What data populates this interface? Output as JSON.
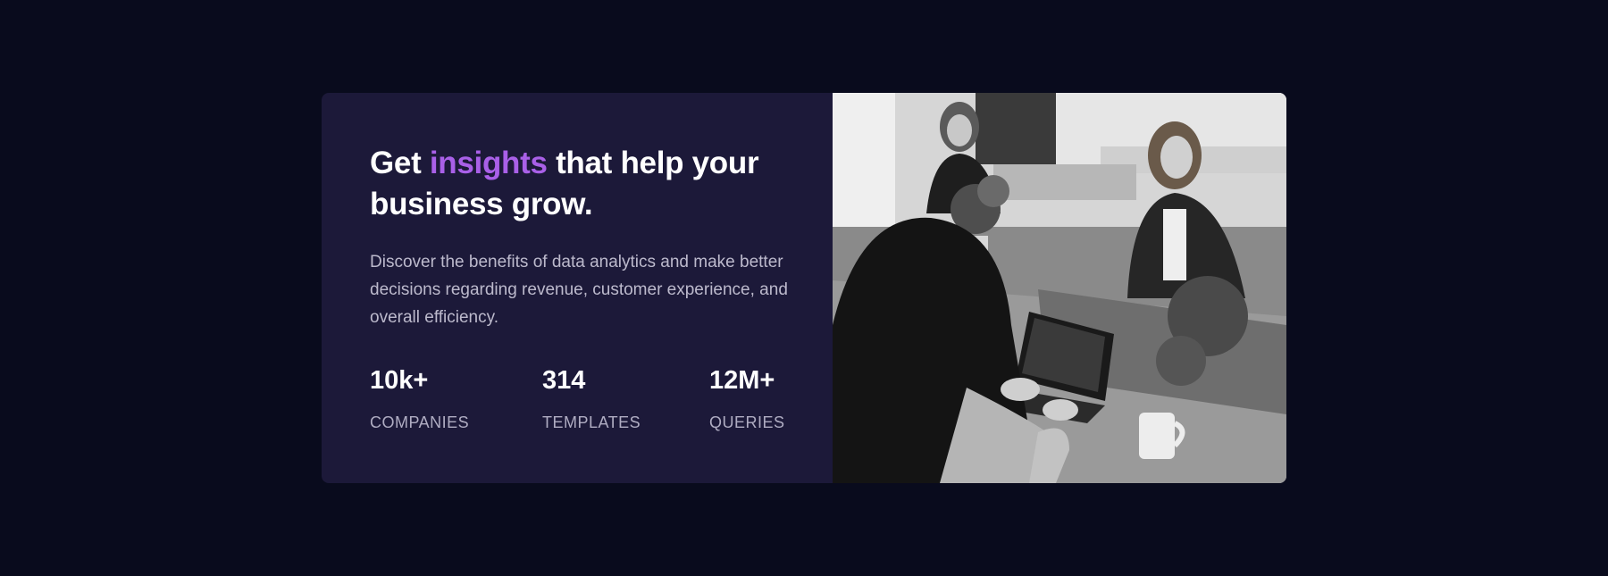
{
  "card": {
    "title_prefix": "Get ",
    "title_accent": "insights",
    "title_suffix": " that help your business grow.",
    "description": "Discover the benefits of data analytics and make better decisions regarding revenue, customer experience, and overall efficiency.",
    "stats": [
      {
        "value": "10k+",
        "label": "COMPANIES"
      },
      {
        "value": "314",
        "label": "TEMPLATES"
      },
      {
        "value": "12M+",
        "label": "QUERIES"
      }
    ],
    "accent_color": "#a960e8",
    "photo_icon": "office-team-photo"
  }
}
